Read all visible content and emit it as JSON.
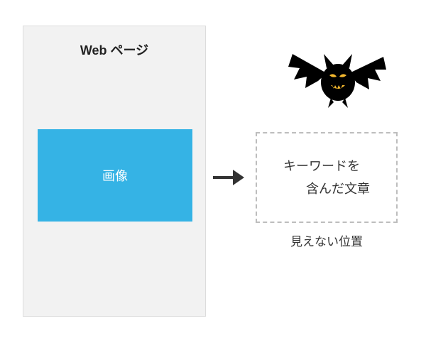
{
  "webpage": {
    "title": "Web ページ",
    "image_label": "画像"
  },
  "hidden": {
    "line1": "キーワードを",
    "line2": "含んだ文章",
    "caption": "見えない位置"
  },
  "icons": {
    "arrow": "arrow-right",
    "bat": "bat-evil"
  },
  "colors": {
    "image_bg": "#35b3e5",
    "page_bg": "#f2f2f2",
    "dashed_border": "#bdbdbd",
    "bat": "#000000",
    "bat_eyes": "#f4b82e"
  }
}
